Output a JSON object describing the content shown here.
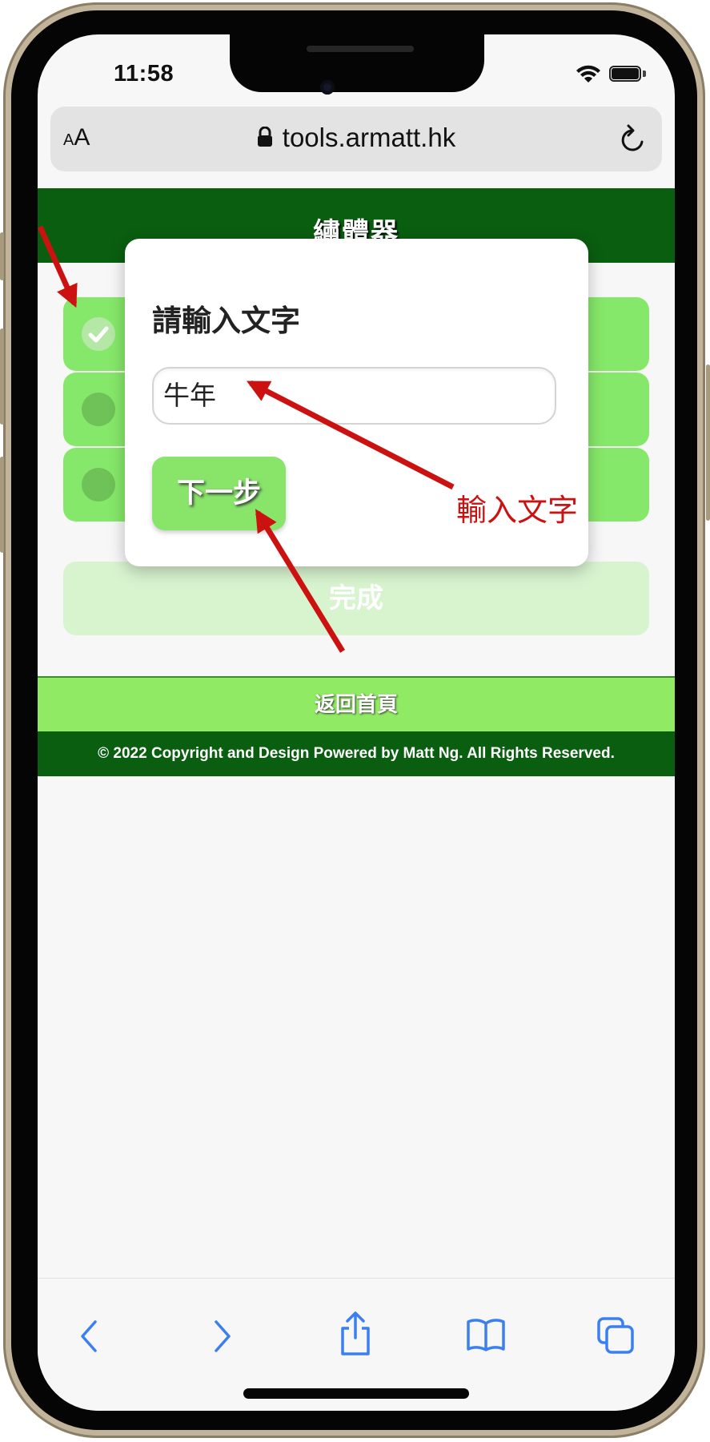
{
  "status_bar": {
    "time": "11:58"
  },
  "browser": {
    "text_size_label_small": "A",
    "text_size_label_large": "A",
    "url": "tools.armatt.hk"
  },
  "site": {
    "title": "繡體器",
    "done_label": "完成",
    "home_link": "返回首頁",
    "footer": "© 2022 Copyright and Design Powered by Matt Ng. All Rights Reserved."
  },
  "modal": {
    "title": "請輸入文字",
    "input_value": "牛年",
    "next_label": "下一步"
  },
  "annotation": {
    "label": "輸入文字",
    "color": "#cc1111"
  },
  "colors": {
    "header": "#0a5e10",
    "step_green": "#86e86a",
    "annotation_red": "#cc1111"
  }
}
